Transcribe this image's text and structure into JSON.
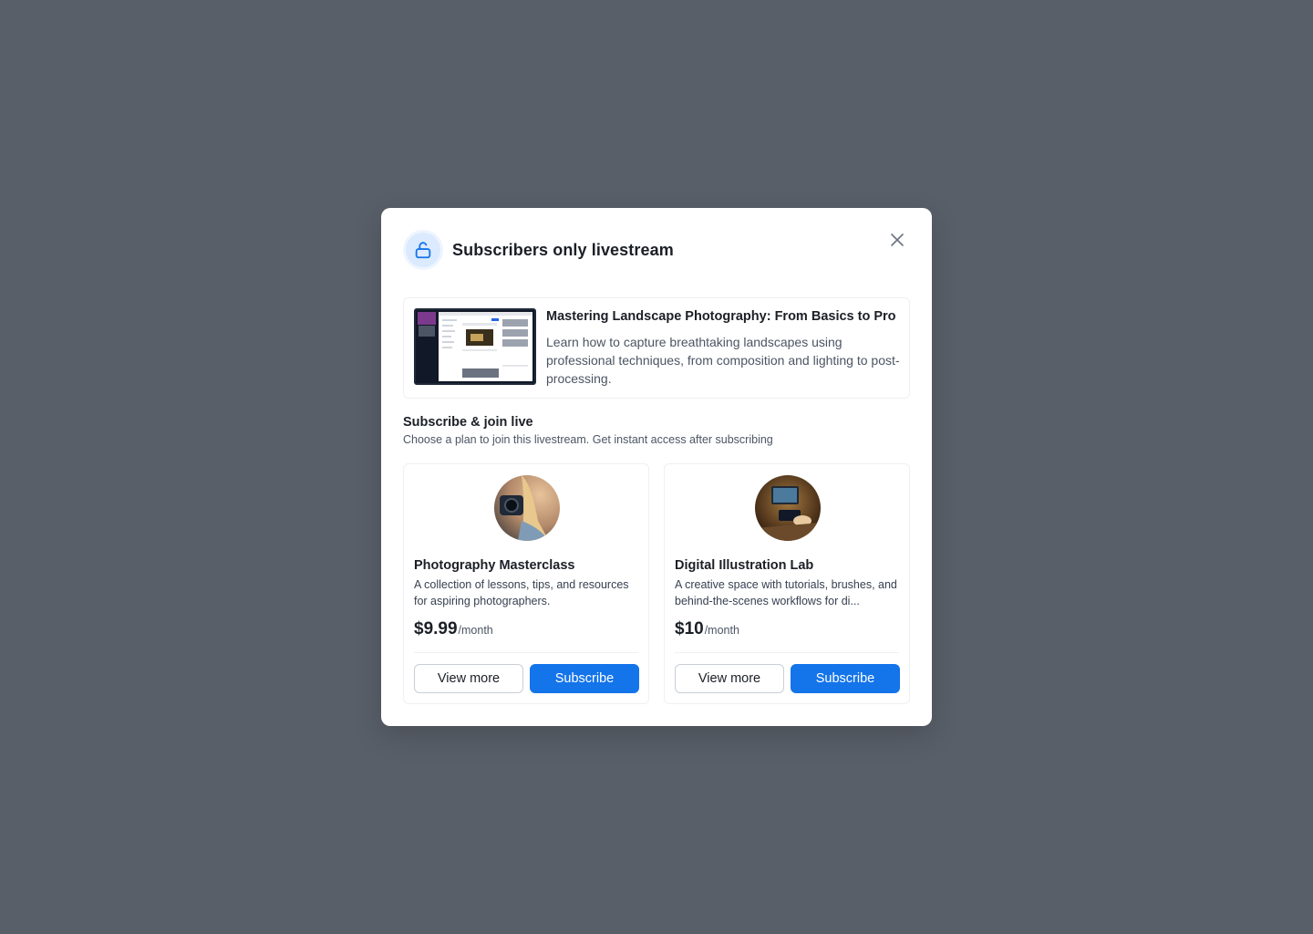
{
  "modal": {
    "title": "Subscribers only livestream",
    "icon": "lock-icon",
    "close_icon": "close-icon"
  },
  "stream": {
    "title": "Mastering Landscape Photography: From Basics to Pro",
    "description": "Learn how to capture breathtaking landscapes using professional techniques, from composition and lighting to post-processing."
  },
  "subscribe": {
    "title": "Subscribe & join live",
    "subtitle": "Choose a plan to join this livestream. Get instant access after subscribing"
  },
  "plans": [
    {
      "name": "Photography Masterclass",
      "description": "A collection of lessons, tips, and resources for aspiring photographers.",
      "price": "$9.99",
      "period": "/month",
      "view_label": "View more",
      "subscribe_label": "Subscribe"
    },
    {
      "name": "Digital Illustration Lab",
      "description": "A creative space with tutorials, brushes, and behind-the-scenes workflows for di...",
      "price": "$10",
      "period": "/month",
      "view_label": "View more",
      "subscribe_label": "Subscribe"
    }
  ],
  "colors": {
    "backdrop": "#595f69",
    "accent": "#1474ea",
    "lock_badge": "#dbeafe"
  }
}
